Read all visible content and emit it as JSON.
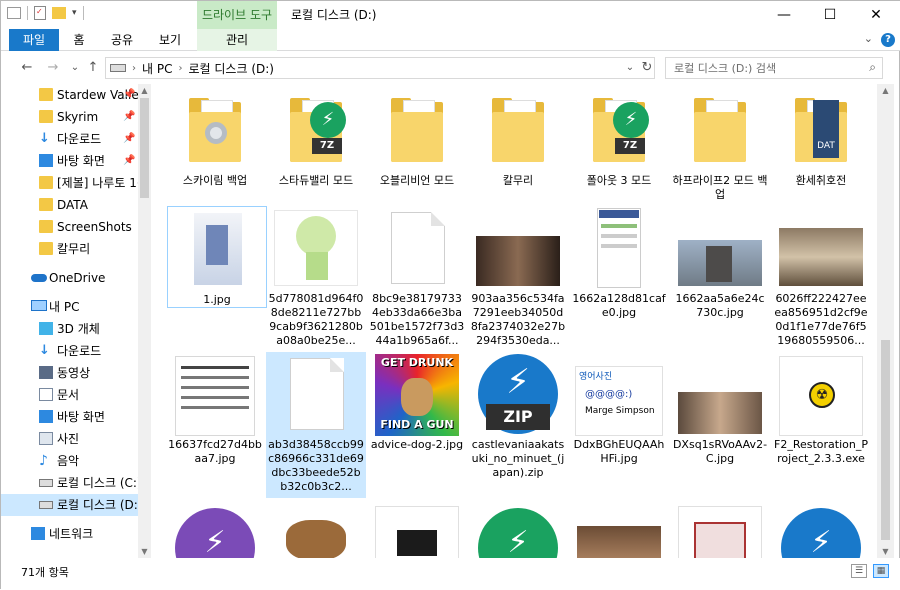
{
  "titlebar": {
    "drive_tools": "드라이브 도구",
    "title": "로컬 디스크 (D:)",
    "qat_separator": "|"
  },
  "window_controls": {
    "minimize": "—",
    "maximize": "☐",
    "close": "✕"
  },
  "ribbon": {
    "tabs": [
      "파일",
      "홈",
      "공유",
      "보기",
      "관리"
    ],
    "collapse": "⌄",
    "help": "?"
  },
  "nav_buttons": {
    "back": "←",
    "forward": "→",
    "recent": "⌄",
    "up": "↑"
  },
  "address": {
    "segments": [
      "내 PC",
      "로컬 디스크 (D:)"
    ],
    "separator": "›",
    "dropdown": "⌄",
    "refresh": "↻"
  },
  "search": {
    "placeholder": "로컬 디스크 (D:) 검색",
    "icon": "⌕"
  },
  "sidebar": {
    "quick_access": [
      {
        "label": "Stardew Valle",
        "icon": "folder-icon",
        "pinned": true
      },
      {
        "label": "Skyrim",
        "icon": "folder-icon",
        "pinned": true
      },
      {
        "label": "다운로드",
        "icon": "download-icon",
        "pinned": true
      },
      {
        "label": "바탕 화면",
        "icon": "desktop-icon",
        "pinned": true
      },
      {
        "label": "[제볼] 나루토 1(",
        "icon": "folder-icon",
        "pinned": false
      },
      {
        "label": "DATA",
        "icon": "folder-icon",
        "pinned": false
      },
      {
        "label": "ScreenShots",
        "icon": "folder-icon",
        "pinned": false
      },
      {
        "label": "칼무리",
        "icon": "folder-icon",
        "pinned": false
      }
    ],
    "onedrive": "OneDrive",
    "this_pc": "내 PC",
    "pc_items": [
      {
        "label": "3D 개체",
        "icon": "3d-objects-icon"
      },
      {
        "label": "다운로드",
        "icon": "download-icon"
      },
      {
        "label": "동영상",
        "icon": "video-icon"
      },
      {
        "label": "문서",
        "icon": "document-icon"
      },
      {
        "label": "바탕 화면",
        "icon": "desktop-icon"
      },
      {
        "label": "사진",
        "icon": "pictures-icon"
      },
      {
        "label": "음악",
        "icon": "music-icon"
      },
      {
        "label": "로컬 디스크 (C:)",
        "icon": "drive-icon"
      },
      {
        "label": "로컬 디스크 (D:)",
        "icon": "drive-icon",
        "selected": true
      }
    ],
    "network": "네트워크",
    "pin_glyph": "📌"
  },
  "files": {
    "row1": [
      {
        "name": "스카이림 백업",
        "kind": "folder"
      },
      {
        "name": "스타듀밸리 모드",
        "kind": "folder-7z"
      },
      {
        "name": "오블리비언 모드",
        "kind": "folder"
      },
      {
        "name": "칼무리",
        "kind": "folder"
      },
      {
        "name": "폴아웃 3 모드",
        "kind": "folder-7z"
      },
      {
        "name": "하프라이프2 모드 백업",
        "kind": "folder"
      },
      {
        "name": "환세취호전",
        "kind": "folder-dat"
      }
    ],
    "row2": [
      {
        "name": "1.jpg",
        "kind": "image"
      },
      {
        "name": "5d778081d964f08de8211e727bb9cab9f3621280ba08a0be25e...",
        "kind": "image"
      },
      {
        "name": "8bc9e381797334eb33da66e3ba501be1572f73d344a1b965a6f...",
        "kind": "blank"
      },
      {
        "name": "903aa356c534fa7291eeb34050d8fa2374032e27b294f3530eda...",
        "kind": "image"
      },
      {
        "name": "1662a128d81cafe0.jpg",
        "kind": "image"
      },
      {
        "name": "1662aa5a6e24c730c.jpg",
        "kind": "image"
      },
      {
        "name": "6026ff222427eeea856951d2cf9e0d1f1e77de76f519680559506...",
        "kind": "image"
      }
    ],
    "row3": [
      {
        "name": "16637fcd27d4bbaa7.jpg",
        "kind": "image"
      },
      {
        "name": "ab3d38458ccb99c86966c331de69dbc33beede52bb32c0b3c2...",
        "kind": "blank"
      },
      {
        "name": "advice-dog-2.jpg",
        "kind": "image"
      },
      {
        "name": "castlevaniaakatsuki_no_minuet_(japan).zip",
        "kind": "zip"
      },
      {
        "name": "DdxBGhEUQAAhHFi.jpg",
        "kind": "image"
      },
      {
        "name": "DXsq1sRVoAAv2-C.jpg",
        "kind": "image"
      },
      {
        "name": "F2_Restoration_Project_2.3.3.exe",
        "kind": "exe"
      }
    ],
    "badges": {
      "seven_z": "7Z",
      "zip": "ZIP",
      "dat": "DAT"
    },
    "thumb_text": {
      "get_drunk": "GET DRUNK",
      "find_a_gun": "FIND A GUN",
      "marge_title": "영어사진",
      "marge_email": "@@@@:)",
      "marge_name": "Marge Simpson"
    }
  },
  "status": {
    "count": "71개 항목",
    "view_details": "☰",
    "view_icons": "▦"
  },
  "scroll_arrows": {
    "up": "▲",
    "down": "▼"
  },
  "colors": {
    "accent": "#1979ca",
    "drive_tools_bg": "#c9eac7",
    "selection": "#cce8ff",
    "folder": "#f3c845",
    "seven_z_green": "#1aa260",
    "zip_blue": "#1979ca"
  }
}
